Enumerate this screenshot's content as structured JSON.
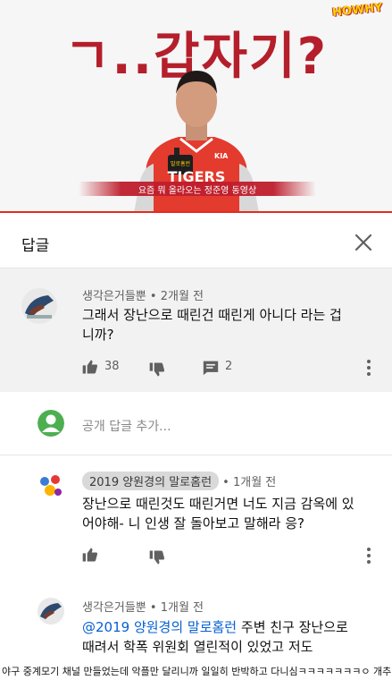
{
  "video": {
    "headline": "ㄱ..갑자기?",
    "caption": "요즘 뭐 올라오는 정준영 동영상",
    "watermark": "HOWHY",
    "watermark_small": "brand",
    "shirt_text": "TIGERS",
    "shirt_brand": "KIA",
    "badge_text": "말로홈런"
  },
  "replies_panel": {
    "title": "답글"
  },
  "parent_comment": {
    "author": "생각은거들뿐",
    "time": "2개월 전",
    "text": "그래서 장난으로 때린건 때린게 아니다 라는 겁니까?",
    "likes": "38",
    "replies": "2"
  },
  "reply_input": {
    "placeholder": "공개 답글 추가..."
  },
  "reply_1": {
    "author": "2019 양원경의 말로홈런",
    "time": "1개월 전",
    "text": "장난으로 때린것도 때린거면 너도 지금 감옥에 있어야해- 니 인생 잘 돌아보고 말해라 응?"
  },
  "reply_2": {
    "author": "생각은거들뿐",
    "time": "1개월 전",
    "mention": "@2019 양원경의 말로홈런",
    "text_after_mention": " 주변 친구 장난으로",
    "text_line2": "때려서 학폭 위원회 열린적이 있었고 저도"
  },
  "bottom_caption": {
    "text": "야구 중계모기 채널 만들었는데 악플만 달리니까 일일히 반박하고 다니심ㅋㅋㅋㅋㅋㅋㅋㅇ 개추"
  },
  "colors": {
    "accent_red": "#e52a1f",
    "headline_red": "#b41f2b",
    "link_blue": "#065fd4",
    "parent_bg": "#f2f2f2"
  },
  "icons": [
    "close-icon",
    "like-icon",
    "dislike-icon",
    "reply-icon",
    "more-icon",
    "user-avatar-icon"
  ]
}
